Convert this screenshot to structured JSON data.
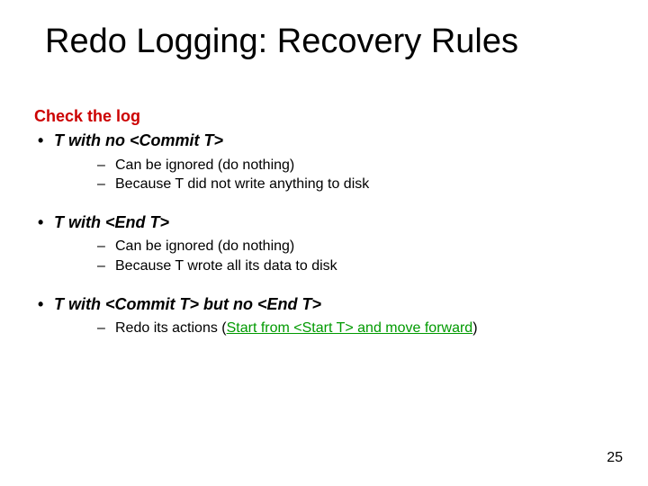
{
  "title": "Redo Logging: Recovery Rules",
  "check_label": "Check the log",
  "items": [
    {
      "heading": "T with no <Commit T>",
      "subs": [
        "Can be ignored (do nothing)",
        "Because T did not write anything to disk"
      ]
    },
    {
      "heading": "T with <End T>",
      "subs": [
        "Can be ignored (do nothing)",
        "Because T wrote all its data to disk"
      ]
    },
    {
      "heading": "T with <Commit T> but no <End T>",
      "subs_rich": [
        {
          "prefix": "Redo its actions  (",
          "green": "Start from <Start T> and move forward",
          "suffix": ")"
        }
      ]
    }
  ],
  "page_number": "25"
}
